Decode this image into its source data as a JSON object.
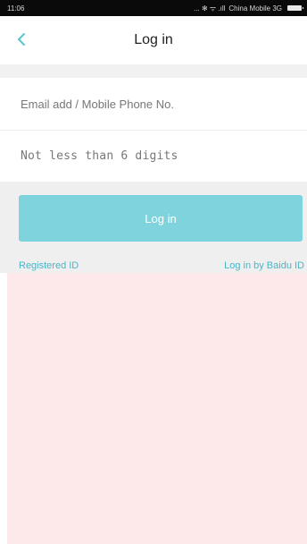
{
  "status_bar": {
    "time": "11:06",
    "signal_text": "... ✻ ᯤ .ıll",
    "carrier": "China Mobile 3G"
  },
  "header": {
    "title": "Log in",
    "back_icon": "chevron-left-icon"
  },
  "form": {
    "email_placeholder": "Email add / Mobile Phone No.",
    "password_placeholder": "Not less than 6 digits",
    "login_label": "Log in"
  },
  "links": {
    "register": "Registered ID",
    "baidu_login": "Log in by Baidu ID"
  },
  "colors": {
    "accent": "#59c4d2",
    "button": "#7ed3dc",
    "link": "#4bb5c6",
    "bottom_background": "#fde9e9"
  }
}
